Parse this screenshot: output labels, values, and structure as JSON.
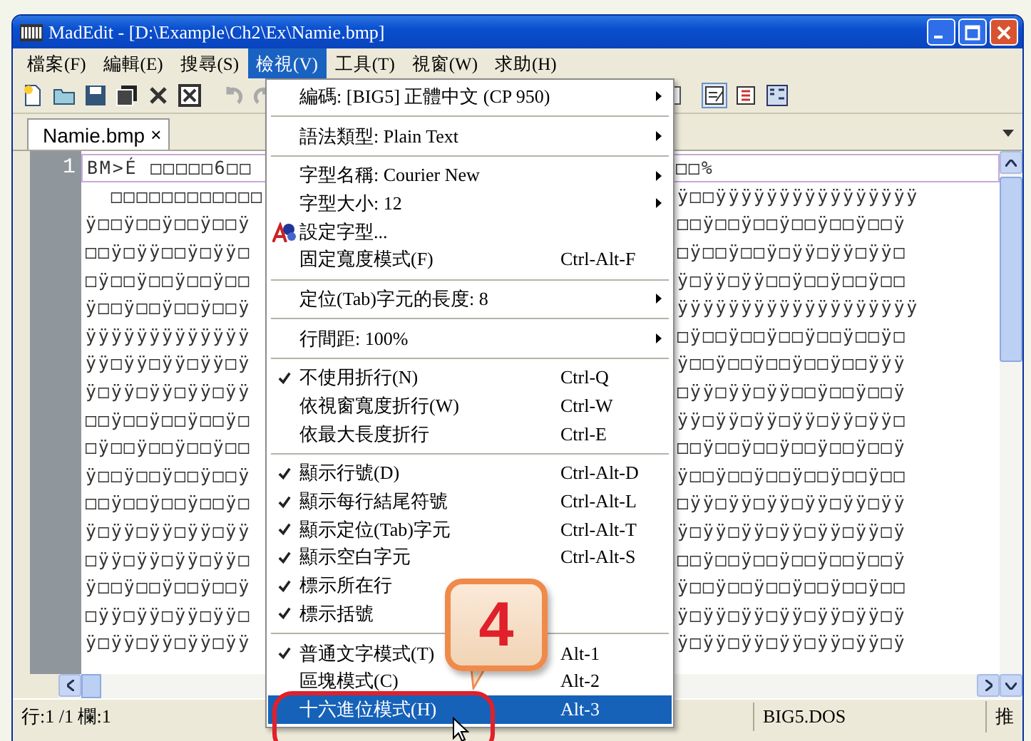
{
  "window": {
    "title": "MadEdit - [D:\\Example\\Ch2\\Ex\\Namie.bmp]"
  },
  "menubar": [
    {
      "label": "檔案(F)",
      "selected": false
    },
    {
      "label": "編輯(E)",
      "selected": false
    },
    {
      "label": "搜尋(S)",
      "selected": false
    },
    {
      "label": "檢視(V)",
      "selected": true
    },
    {
      "label": "工具(T)",
      "selected": false
    },
    {
      "label": "視窗(W)",
      "selected": false
    },
    {
      "label": "求助(H)",
      "selected": false
    }
  ],
  "tabs": [
    {
      "label": "Namie.bmp",
      "close": "×",
      "selected": true
    }
  ],
  "editor": {
    "line_number": "1",
    "rows": [
      {
        "left": "BM>É □□□□□6□□",
        "right": "□□%"
      },
      {
        "left": "  □□□□□□□□□□□□",
        "right": "ÿ□□ÿÿÿÿÿÿÿÿÿÿÿÿÿÿÿÿ"
      },
      {
        "left": "ÿ□□ÿ□□ÿ□□ÿ□□ÿ",
        "right": "□□ÿ□□ÿ□□ÿ□□ÿ□□ÿ□□ÿ"
      },
      {
        "left": "□□ÿ□ÿÿ□□ÿ□ÿÿ□",
        "right": "□ÿ□□ÿ□□ÿ□ÿÿ□ÿÿ□ÿÿ□"
      },
      {
        "left": "□ÿ□□ÿ□□ÿ□□ÿ□□",
        "right": "ÿ□ÿÿ□ÿÿ□□ÿ□□ÿ□□ÿ□□"
      },
      {
        "left": "ÿ□□ÿ□□ÿ□□ÿ□□ÿ",
        "right": "ÿÿÿÿÿÿÿÿÿÿÿÿÿÿÿÿÿÿÿ"
      },
      {
        "left": "ÿÿÿÿÿÿÿÿÿÿÿÿÿ",
        "right": "□ÿ□□ÿ□□ÿ□□ÿ□□ÿ□□ÿ□"
      },
      {
        "left": "ÿÿ□ÿÿ□ÿÿ□ÿÿ□ÿ",
        "right": "ÿ□□ÿ□□ÿ□□ÿ□□ÿ□□ÿÿÿ"
      },
      {
        "left": "ÿ□ÿÿ□ÿÿ□ÿÿ□ÿÿ",
        "right": "□ÿÿ□ÿÿ□ÿÿ□□ÿ□□ÿ□□ÿ"
      },
      {
        "left": "□□ÿ□□ÿ□□ÿ□□ÿ□",
        "right": "ÿÿ□ÿÿ□ÿÿ□ÿÿ□ÿÿ□ÿÿ□"
      },
      {
        "left": "□ÿ□□ÿ□□ÿ□□ÿ□□",
        "right": "□□ÿ□□ÿ□□ÿ□□ÿ□□ÿ□□ÿ"
      },
      {
        "left": "ÿ□□ÿ□□ÿ□□ÿ□□ÿ",
        "right": "ÿ□□ÿ□□ÿ□□ÿ□□ÿ□□ÿ□□"
      },
      {
        "left": "□□ÿ□□ÿ□□ÿ□□ÿ□",
        "right": "□ÿÿ□ÿÿ□ÿÿ□ÿÿ□ÿÿ□ÿÿ"
      },
      {
        "left": "ÿ□ÿÿ□ÿÿ□ÿÿ□ÿÿ",
        "right": "ÿ□ÿÿ□ÿÿ□ÿÿ□ÿÿ□ÿÿ□ÿ"
      },
      {
        "left": "□ÿÿ□ÿÿ□ÿÿ□ÿÿ□",
        "right": "□□ÿ□□ÿ□□ÿ□□ÿ□□ÿ□□ÿ"
      },
      {
        "left": "ÿ□□ÿ□□ÿ□□ÿ□□ÿ",
        "right": "ÿ□□ÿ□□ÿ□□ÿ□□ÿ□□ÿ□□"
      },
      {
        "left": "□ÿÿ□ÿÿ□ÿÿ□ÿÿ□",
        "right": "ÿ□ÿÿ□ÿÿ□ÿÿ□ÿÿ□ÿÿ□ÿ"
      },
      {
        "left": "ÿ□ÿÿ□ÿÿ□ÿÿ□ÿÿ",
        "right": "ÿ□ÿÿ□ÿÿ□ÿÿ□ÿÿ□ÿÿ□ÿ"
      }
    ]
  },
  "menu": {
    "items": [
      {
        "kind": "item",
        "label": "編碼: [BIG5] 正體中文 (CP 950)",
        "submenu": true,
        "checked": false,
        "selected": false
      },
      {
        "kind": "separator"
      },
      {
        "kind": "item",
        "label": "語法類型: Plain Text",
        "submenu": true,
        "checked": false,
        "selected": false
      },
      {
        "kind": "separator"
      },
      {
        "kind": "item",
        "label": "字型名稱: Courier New",
        "submenu": true,
        "checked": false,
        "selected": false
      },
      {
        "kind": "item",
        "label": "字型大小: 12",
        "submenu": true,
        "checked": false,
        "selected": false
      },
      {
        "kind": "icon",
        "label": "設定字型...",
        "checked": false,
        "selected": false
      },
      {
        "kind": "item",
        "label": "固定寬度模式(F)",
        "shortcut": "Ctrl-Alt-F",
        "checked": false,
        "selected": false
      },
      {
        "kind": "separator"
      },
      {
        "kind": "item",
        "label": "定位(Tab)字元的長度: 8",
        "submenu": true,
        "checked": false,
        "selected": false
      },
      {
        "kind": "separator"
      },
      {
        "kind": "item",
        "label": "行間距: 100%",
        "submenu": true,
        "checked": false,
        "selected": false
      },
      {
        "kind": "separator"
      },
      {
        "kind": "item",
        "label": "不使用折行(N)",
        "shortcut": "Ctrl-Q",
        "checked": true,
        "selected": false
      },
      {
        "kind": "item",
        "label": "依視窗寬度折行(W)",
        "shortcut": "Ctrl-W",
        "checked": false,
        "selected": false
      },
      {
        "kind": "item",
        "label": "依最大長度折行",
        "shortcut": "Ctrl-E",
        "checked": false,
        "selected": false
      },
      {
        "kind": "separator"
      },
      {
        "kind": "item",
        "label": "顯示行號(D)",
        "shortcut": "Ctrl-Alt-D",
        "checked": true,
        "selected": false
      },
      {
        "kind": "item",
        "label": "顯示每行結尾符號",
        "shortcut": "Ctrl-Alt-L",
        "checked": true,
        "selected": false
      },
      {
        "kind": "item",
        "label": "顯示定位(Tab)字元",
        "shortcut": "Ctrl-Alt-T",
        "checked": true,
        "selected": false
      },
      {
        "kind": "item",
        "label": "顯示空白字元",
        "shortcut": "Ctrl-Alt-S",
        "checked": true,
        "selected": false
      },
      {
        "kind": "item",
        "label": "標示所在行",
        "checked": true,
        "selected": false
      },
      {
        "kind": "item",
        "label": "標示括號",
        "checked": true,
        "selected": false
      },
      {
        "kind": "separator"
      },
      {
        "kind": "item",
        "label": "普通文字模式(T)",
        "shortcut": "Alt-1",
        "checked": true,
        "selected": false
      },
      {
        "kind": "item",
        "label": "區塊模式(C)",
        "shortcut": "Alt-2",
        "checked": false,
        "selected": false
      },
      {
        "kind": "item",
        "label": "十六進位模式(H)",
        "shortcut": "Alt-3",
        "checked": false,
        "selected": true
      }
    ]
  },
  "callout": {
    "text": "4"
  },
  "status_bar": [
    "行:1 /1 欄:1",
    "BIG5.DOS",
    "推"
  ]
}
